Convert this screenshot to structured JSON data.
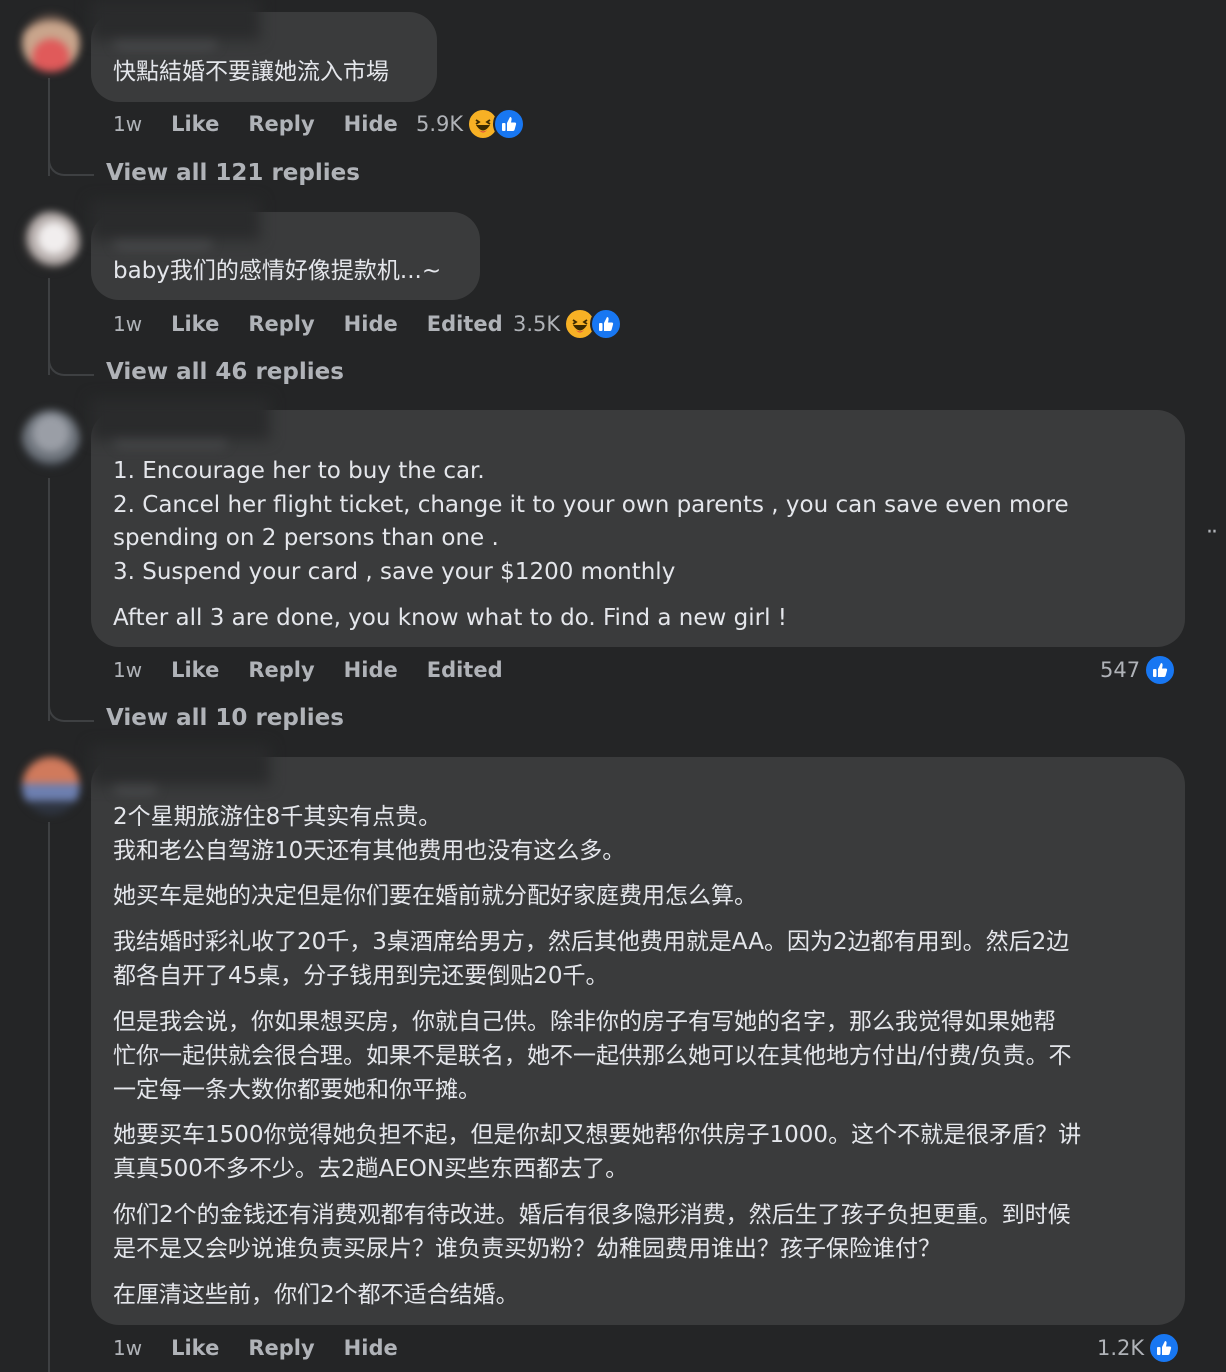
{
  "comments": [
    {
      "lines": [
        "快點結婚不要讓她流入市場"
      ],
      "actions": {
        "time": "1w",
        "like": "Like",
        "reply": "Reply",
        "hide": "Hide"
      },
      "reactions": {
        "count": "5.9K",
        "icons": [
          "haha-icon",
          "like-icon"
        ]
      },
      "view_replies": "View all 121 replies"
    },
    {
      "lines": [
        "baby我们的感情好像提款机...~"
      ],
      "actions": {
        "time": "1w",
        "like": "Like",
        "reply": "Reply",
        "hide": "Hide",
        "edited": "Edited"
      },
      "reactions": {
        "count": "3.5K",
        "icons": [
          "haha-icon",
          "like-icon"
        ]
      },
      "view_replies": "View all 46 replies"
    },
    {
      "lines": [
        "1. Encourage her to buy the car.",
        "2. Cancel her flight ticket, change it to your own parents , you can save even more",
        "spending on 2 persons than one .",
        "3. Suspend your card , save your $1200 monthly",
        "After all 3 are done, you know what to do. Find a new girl !"
      ],
      "actions": {
        "time": "1w",
        "like": "Like",
        "reply": "Reply",
        "hide": "Hide",
        "edited": "Edited"
      },
      "reactions": {
        "count": "547",
        "icons": [
          "like-icon"
        ]
      },
      "view_replies": "View all 10 replies"
    },
    {
      "lines": [
        "2个星期旅游住8千其实有点贵。",
        "我和老公自驾游10天还有其他费用也没有这么多。",
        "她买车是她的决定但是你们要在婚前就分配好家庭费用怎么算。",
        "我结婚时彩礼收了20千，3桌酒席给男方，然后其他费用就是AA。因为2边都有用到。然后2边",
        "都各自开了45桌，分子钱用到完还要倒贴20千。",
        "但是我会说，你如果想买房，你就自己供。除非你的房子有写她的名字，那么我觉得如果她帮",
        "忙你一起供就会很合理。如果不是联名，她不一起供那么她可以在其他地方付出/付费/负责。不",
        "一定每一条大数你都要她和你平摊。",
        "她要买车1500你觉得她负担不起，但是你却又想要她帮你供房子1000。这个不就是很矛盾？讲",
        "真真500不多不少。去2趟AEON买些东西都去了。",
        "你们2个的金钱还有消费观都有待改进。婚后有很多隐形消费，然后生了孩子负担更重。到时候",
        "是不是又会吵说谁负责买尿片？谁负责买奶粉？幼稚园费用谁出？孩子保险谁付？",
        "在厘清这些前，你们2个都不适合结婚。"
      ],
      "actions": {
        "time": "1w",
        "like": "Like",
        "reply": "Reply",
        "hide": "Hide"
      },
      "reactions": {
        "count": "1.2K",
        "icons": [
          "like-icon"
        ]
      }
    }
  ],
  "more_menu": "··",
  "colors": {
    "background": "#242526",
    "bubble": "#3a3b3c",
    "text": "#e4e6eb",
    "secondary": "#b0b3b8",
    "like": "#1877f2",
    "haha": "#f7b125"
  }
}
